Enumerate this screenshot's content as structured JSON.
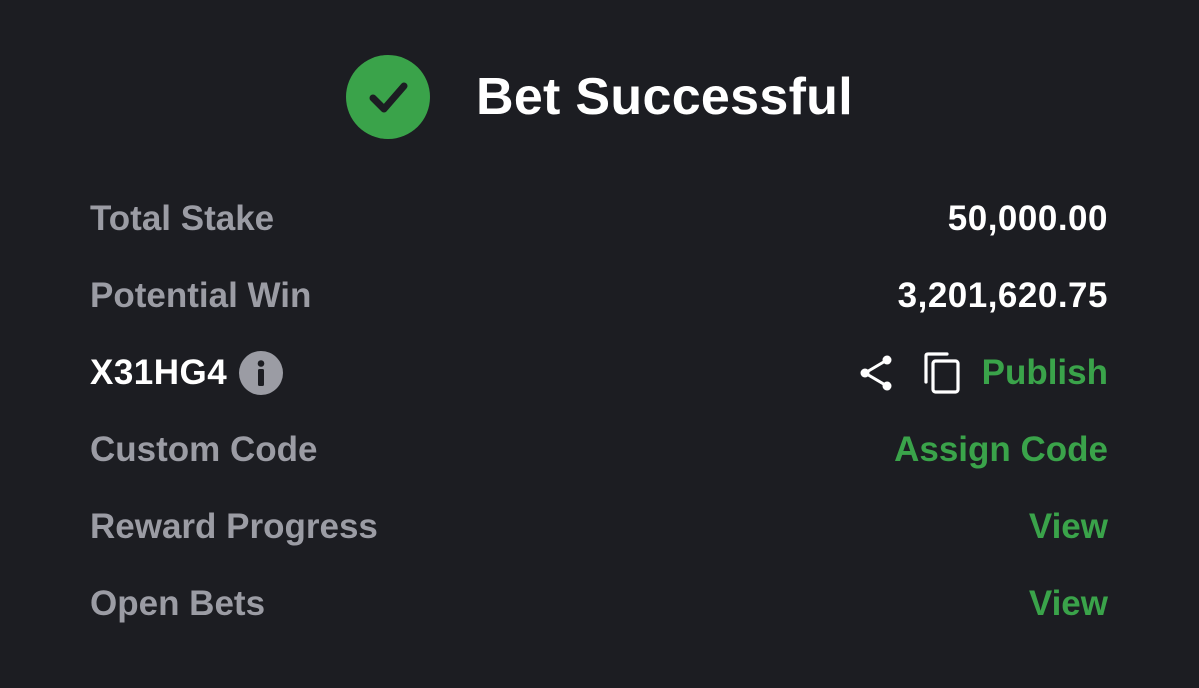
{
  "header": {
    "title": "Bet Successful",
    "icon": "check-circle-icon",
    "accent_color": "#3aa34a"
  },
  "details": {
    "total_stake": {
      "label": "Total Stake",
      "value": "50,000.00"
    },
    "potential_win": {
      "label": "Potential Win",
      "value": "3,201,620.75"
    },
    "booking": {
      "code": "X31HG4",
      "info_icon": "info-icon",
      "share_icon": "share-icon",
      "copy_icon": "copy-icon",
      "publish_label": "Publish"
    },
    "custom_code": {
      "label": "Custom Code",
      "action": "Assign Code"
    },
    "reward_progress": {
      "label": "Reward Progress",
      "action": "View"
    },
    "open_bets": {
      "label": "Open Bets",
      "action": "View"
    }
  },
  "colors": {
    "background": "#1c1d22",
    "label_gray": "#9b9ca4",
    "value_white": "#ffffff",
    "link_green": "#3aa34a"
  }
}
